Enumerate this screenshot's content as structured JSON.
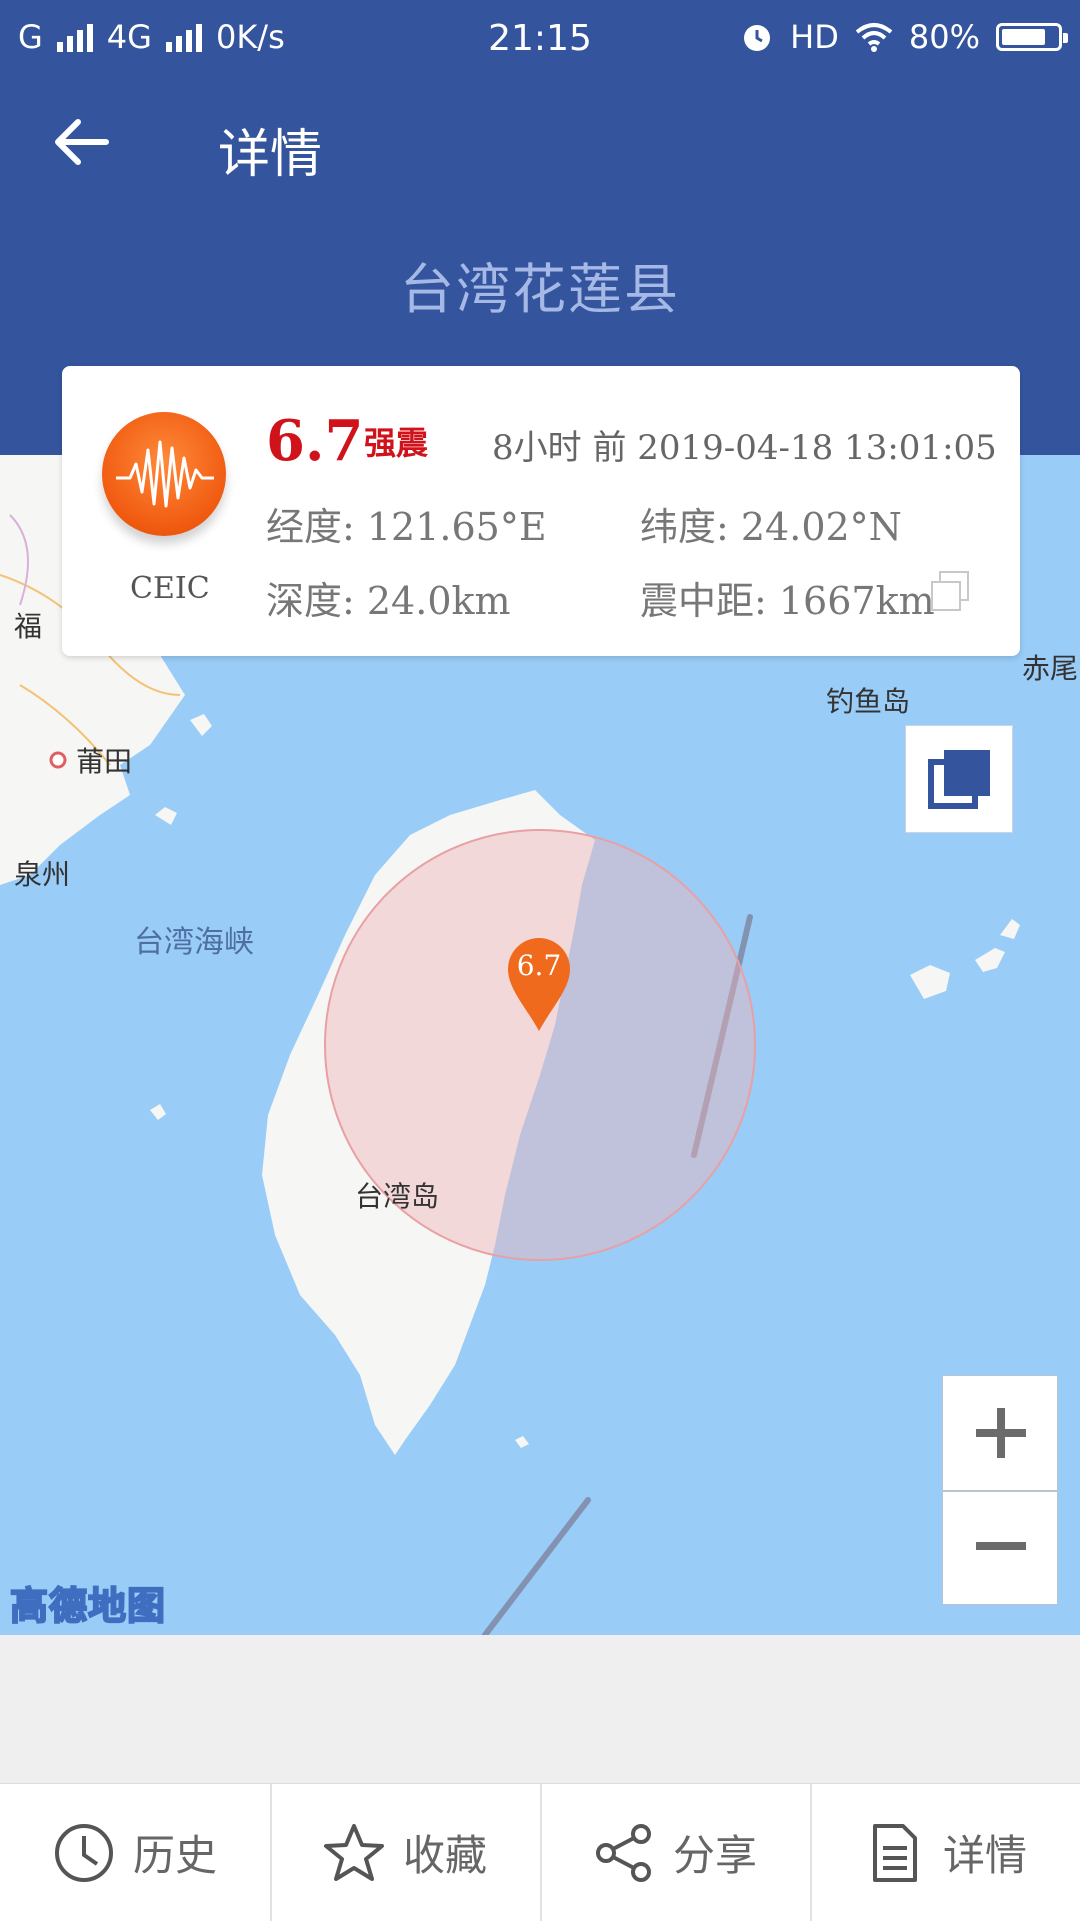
{
  "status_bar": {
    "carrier": "G",
    "network": "4G",
    "speed": "0K/s",
    "time": "21:15",
    "hd": "HD",
    "battery": "80%",
    "battery_level": 0.8
  },
  "header": {
    "back_icon": "arrow-left-icon",
    "title": "详情",
    "location": "台湾花莲县"
  },
  "quake": {
    "agency": "CEIC",
    "magnitude": "6.7",
    "level": "强震",
    "time": "8小时 前 2019-04-18 13:01:05",
    "longitude": "经度: 121.65°E",
    "latitude": "纬度: 24.02°N",
    "depth": "深度: 24.0km",
    "distance": "震中距: 1667km"
  },
  "map": {
    "labels": {
      "fu": "福",
      "putian": "莆田",
      "quanzhou": "泉州",
      "strait": "台湾海峡",
      "island": "台湾岛",
      "diaoyu": "钓鱼岛",
      "chiwei": "赤尾"
    },
    "marker_value": "6.7",
    "logo": "高德地图",
    "layer_icon": "layers-icon",
    "zoom_in": "+",
    "zoom_out": "−"
  },
  "nav": [
    {
      "icon": "clock-icon",
      "label": "历史"
    },
    {
      "icon": "star-icon",
      "label": "收藏"
    },
    {
      "icon": "share-icon",
      "label": "分享"
    },
    {
      "icon": "document-icon",
      "label": "详情"
    }
  ],
  "colors": {
    "header": "#34559e",
    "sea": "#99ccf7",
    "magnitude": "#d0121b",
    "marker": "#f06a1e"
  }
}
